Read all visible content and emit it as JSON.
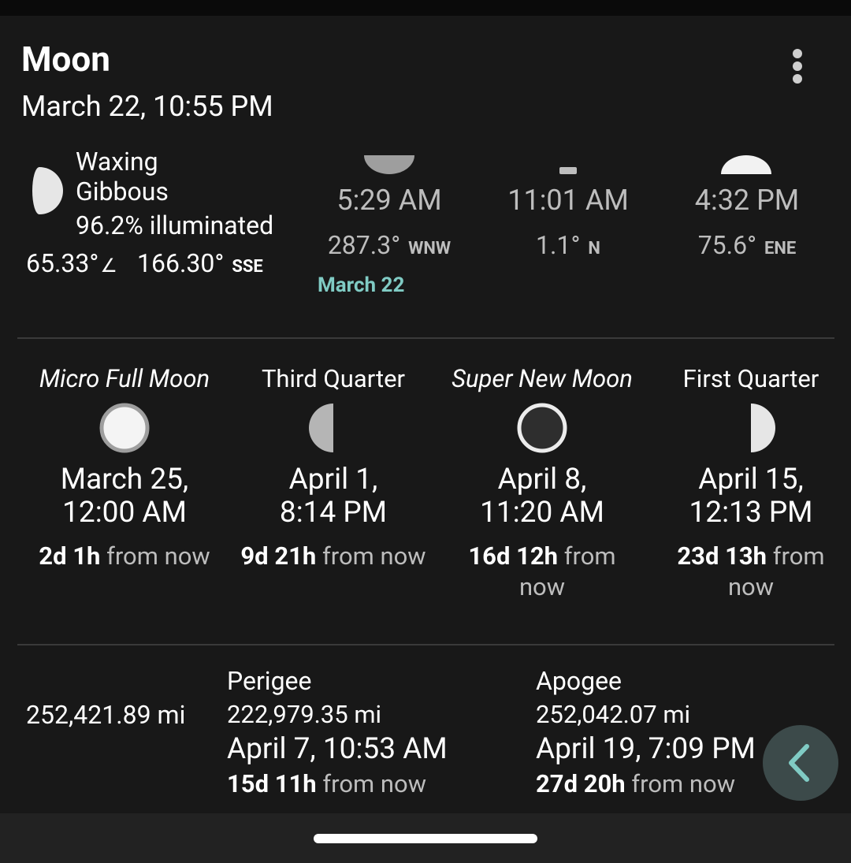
{
  "app": {
    "title": "Moon",
    "subtitle": "March 22, 10:55 PM",
    "menu_icon": "more-vertical-icon"
  },
  "current": {
    "phase_line1": "Waxing",
    "phase_line2": "Gibbous",
    "illumination": "96.2% illuminated",
    "illumination_fraction": 0.962,
    "altitude": "65.33°",
    "altitude_icon": "∠",
    "azimuth": "166.30°",
    "azimuth_dir": "SSE"
  },
  "rise_set": [
    {
      "icon": "moonrise-icon",
      "time": "5:29 AM",
      "azimuth": "287.3°",
      "dir": "WNW"
    },
    {
      "icon": "moon-transit-icon",
      "time": "11:01 AM",
      "azimuth": "1.1°",
      "dir": "N"
    },
    {
      "icon": "moonset-icon",
      "time": "4:32 PM",
      "azimuth": "75.6°",
      "dir": "ENE"
    }
  ],
  "rise_set_date": "March 22",
  "phases": [
    {
      "name": "Micro Full Moon",
      "italic": true,
      "icon": "full-moon-icon",
      "date_line1": "March 25,",
      "date_line2": "12:00 AM",
      "rel_bold": "2d 1h",
      "rel_rest": "from now"
    },
    {
      "name": "Third Quarter",
      "italic": false,
      "icon": "third-quarter-icon",
      "date_line1": "April 1,",
      "date_line2": "8:14 PM",
      "rel_bold": "9d 21h",
      "rel_rest": "from now"
    },
    {
      "name": "Super New Moon",
      "italic": true,
      "icon": "new-moon-icon",
      "date_line1": "April 8,",
      "date_line2": "11:20 AM",
      "rel_bold": "16d 12h",
      "rel_rest": "from now"
    },
    {
      "name": "First Quarter",
      "italic": false,
      "icon": "first-quarter-icon",
      "date_line1": "April 15,",
      "date_line2": "12:13 PM",
      "rel_bold": "23d 13h",
      "rel_rest": "from now"
    }
  ],
  "distance": {
    "current": "252,421.89 mi",
    "perigee": {
      "label": "Perigee",
      "distance": "222,979.35 mi",
      "date": "April 7, 10:53 AM",
      "rel_bold": "15d 11h",
      "rel_rest": "from now"
    },
    "apogee": {
      "label": "Apogee",
      "distance": "252,042.07 mi",
      "date": "April 19, 7:09 PM",
      "rel_bold": "27d 20h",
      "rel_rest": "from now"
    }
  },
  "back_icon": "chevron-left-icon",
  "colors": {
    "accent": "#80cbc4",
    "card_bg": "#181818",
    "muted": "#bdbdbd"
  }
}
